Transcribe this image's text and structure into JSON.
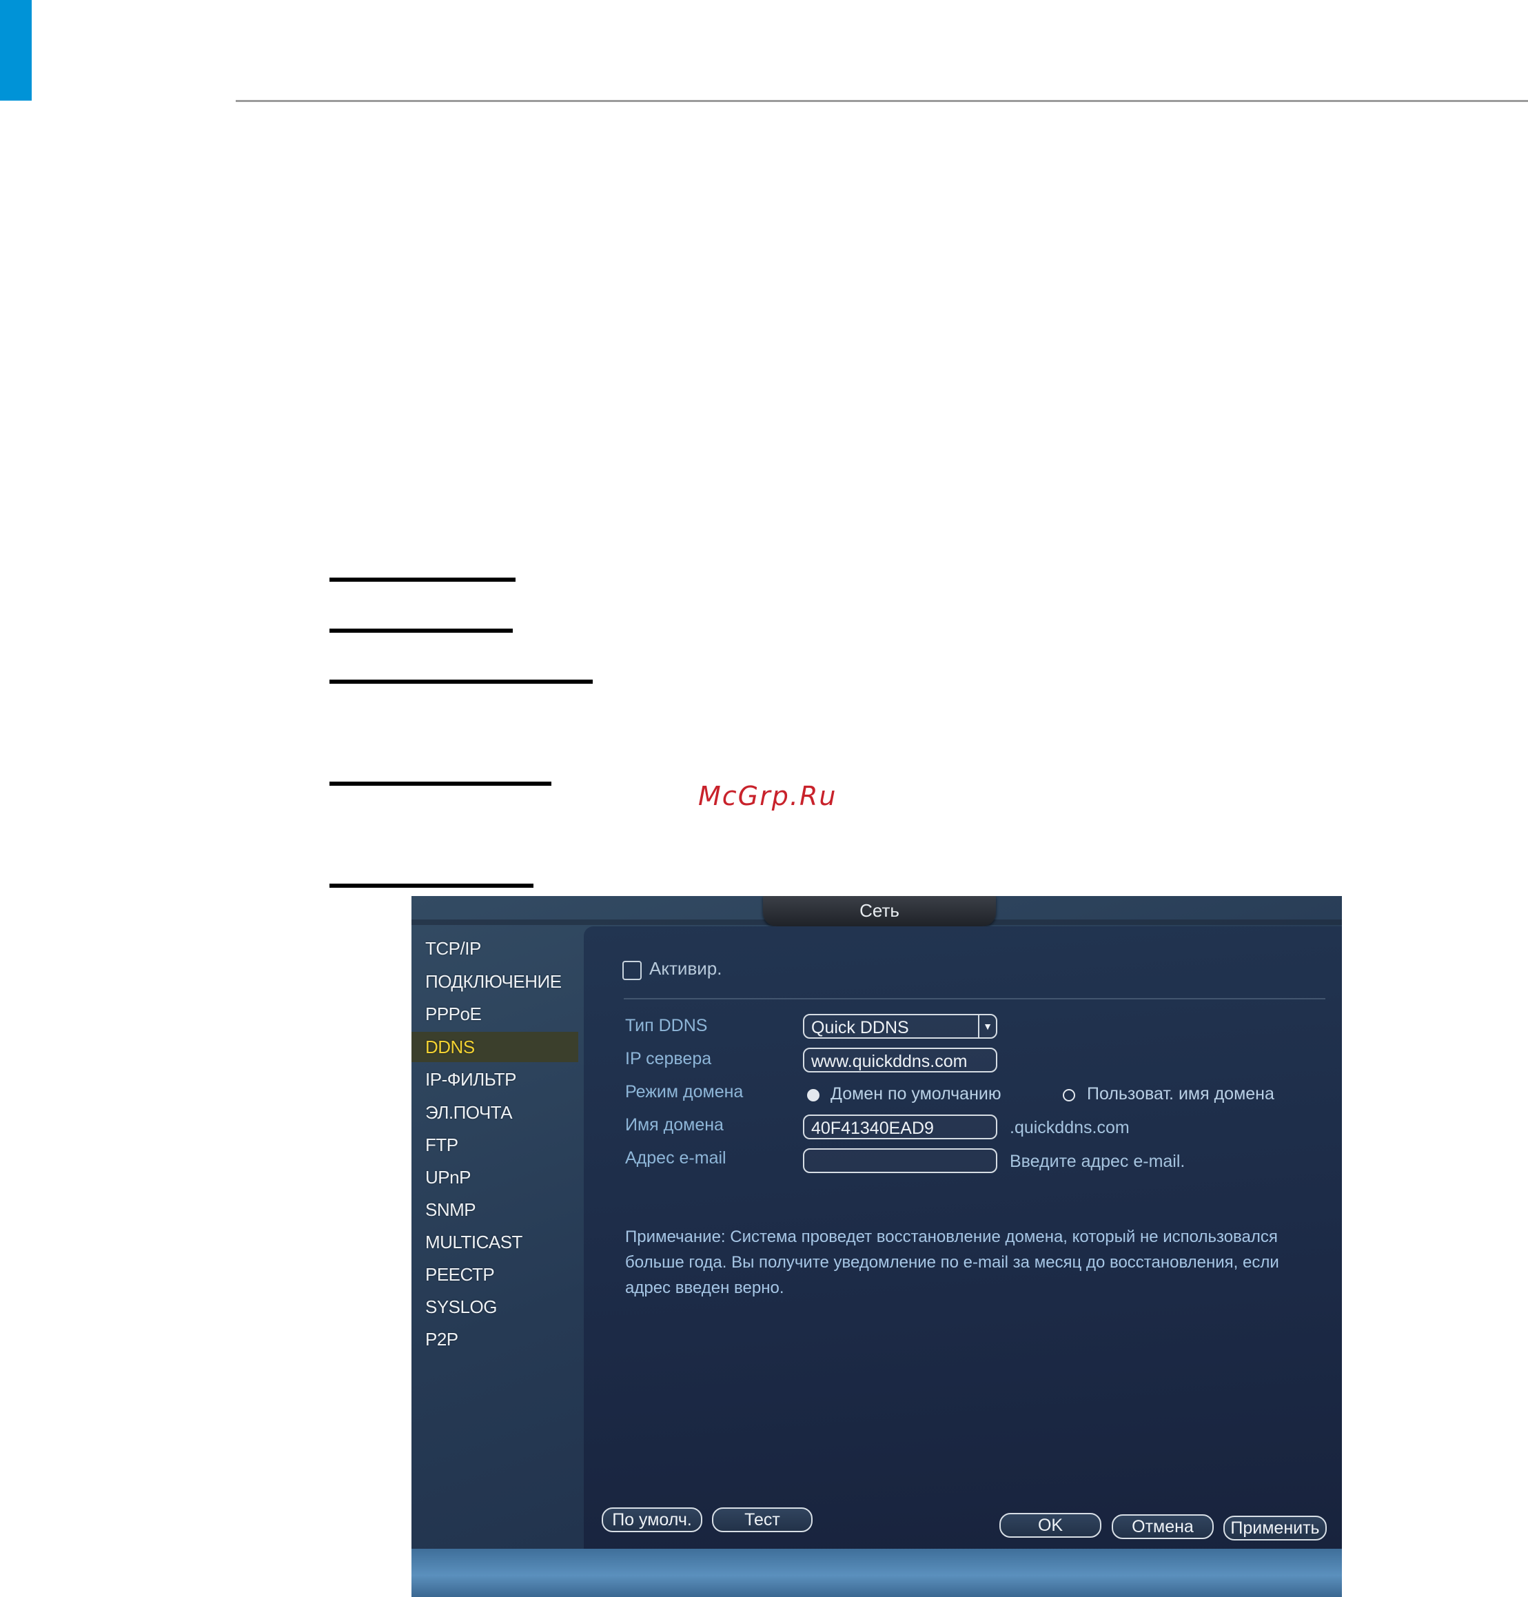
{
  "watermark": "McGrp.Ru",
  "window": {
    "title": "Сеть"
  },
  "sidebar": {
    "items": [
      {
        "label": "TCP/IP"
      },
      {
        "label": "ПОДКЛЮЧЕНИЕ"
      },
      {
        "label": "PPPoE"
      },
      {
        "label": "DDNS",
        "active": true
      },
      {
        "label": "IP-ФИЛЬТР"
      },
      {
        "label": "ЭЛ.ПОЧТА"
      },
      {
        "label": "FTP"
      },
      {
        "label": "UPnP"
      },
      {
        "label": "SNMP"
      },
      {
        "label": "MULTICAST"
      },
      {
        "label": "РЕЕСТР"
      },
      {
        "label": "SYSLOG"
      },
      {
        "label": "P2P"
      }
    ]
  },
  "ddns": {
    "enable_label": "Активир.",
    "type_label": "Тип DDNS",
    "type_value": "Quick DDNS",
    "server_label": "IP сервера",
    "server_value": "www.quickddns.com",
    "mode_label": "Режим домена",
    "mode_default": "Домен по умолчанию",
    "mode_custom": "Пользоват. имя домена",
    "domain_label": "Имя домена",
    "domain_value": "40F41340EAD9",
    "domain_suffix": ".quickddns.com",
    "email_label": "Адрес e-mail",
    "email_value": "",
    "email_hint": "Введите адрес e-mail.",
    "note": "Примечание: Система проведет восстановление домена, который не использовался больше года. Вы получите уведомление по e-mail за месяц до восстановления, если адрес введен верно."
  },
  "buttons": {
    "default": "По умолч.",
    "test": "Тест",
    "ok": "OK",
    "cancel": "Отмена",
    "apply": "Применить"
  },
  "colors": {
    "accent_blue": "#0093d7",
    "active_menu_text": "#f2d232",
    "watermark": "#c8222b"
  }
}
